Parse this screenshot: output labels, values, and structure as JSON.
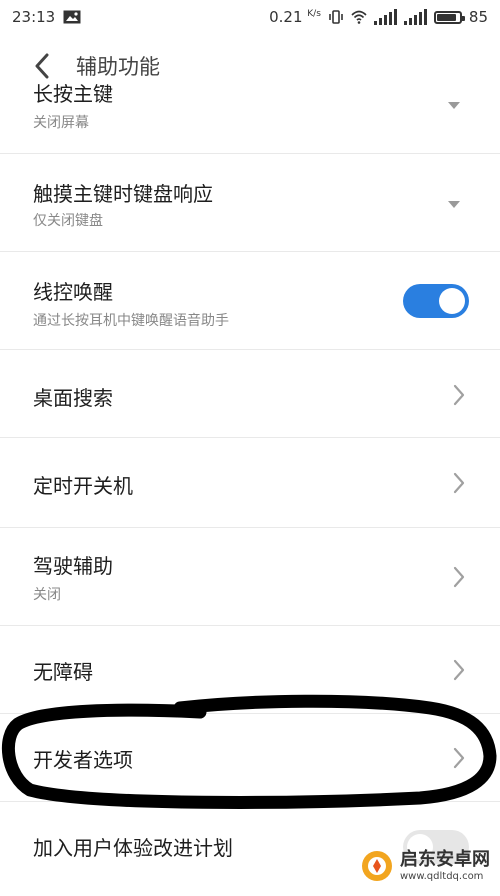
{
  "status_bar": {
    "time": "23:13",
    "net_speed": "0.21",
    "net_unit": "K/s",
    "battery": "85",
    "battery_level": 0.85
  },
  "header": {
    "title": "辅助功能"
  },
  "items": [
    {
      "title": "长按主键",
      "subtitle": "关闭屏幕",
      "control": "dropdown"
    },
    {
      "title": "触摸主键时键盘响应",
      "subtitle": "仅关闭键盘",
      "control": "dropdown"
    },
    {
      "title": "线控唤醒",
      "subtitle": "通过长按耳机中键唤醒语音助手",
      "control": "toggle",
      "enabled": true
    },
    {
      "title": "桌面搜索",
      "subtitle": "",
      "control": "chevron"
    },
    {
      "title": "定时开关机",
      "subtitle": "",
      "control": "chevron"
    },
    {
      "title": "驾驶辅助",
      "subtitle": "关闭",
      "control": "chevron"
    },
    {
      "title": "无障碍",
      "subtitle": "",
      "control": "chevron"
    },
    {
      "title": "开发者选项",
      "subtitle": "",
      "control": "chevron"
    },
    {
      "title": "加入用户体验改进计划",
      "subtitle": "",
      "control": "toggle",
      "enabled": false
    }
  ],
  "watermark": {
    "name": "启东安卓网",
    "url": "www.qdltdq.com"
  },
  "colors": {
    "accent": "#2a7fe0",
    "annotation": "#000000"
  }
}
